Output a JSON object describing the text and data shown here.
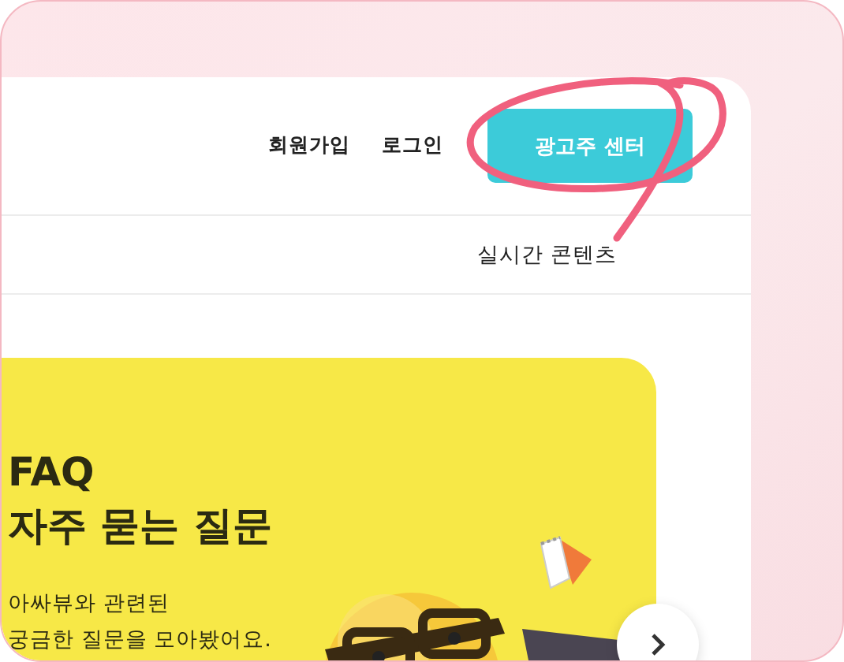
{
  "header": {
    "links": [
      "회원가입",
      "로그인"
    ],
    "cta_button": "광고주 센터"
  },
  "nav": {
    "items": [
      "실시간 콘텐츠"
    ]
  },
  "banner": {
    "title": "FAQ",
    "heading": "자주 묻는 질문",
    "description": [
      "아싸뷰와 관련된",
      "궁금한 질문을 모아봤어요."
    ]
  }
}
